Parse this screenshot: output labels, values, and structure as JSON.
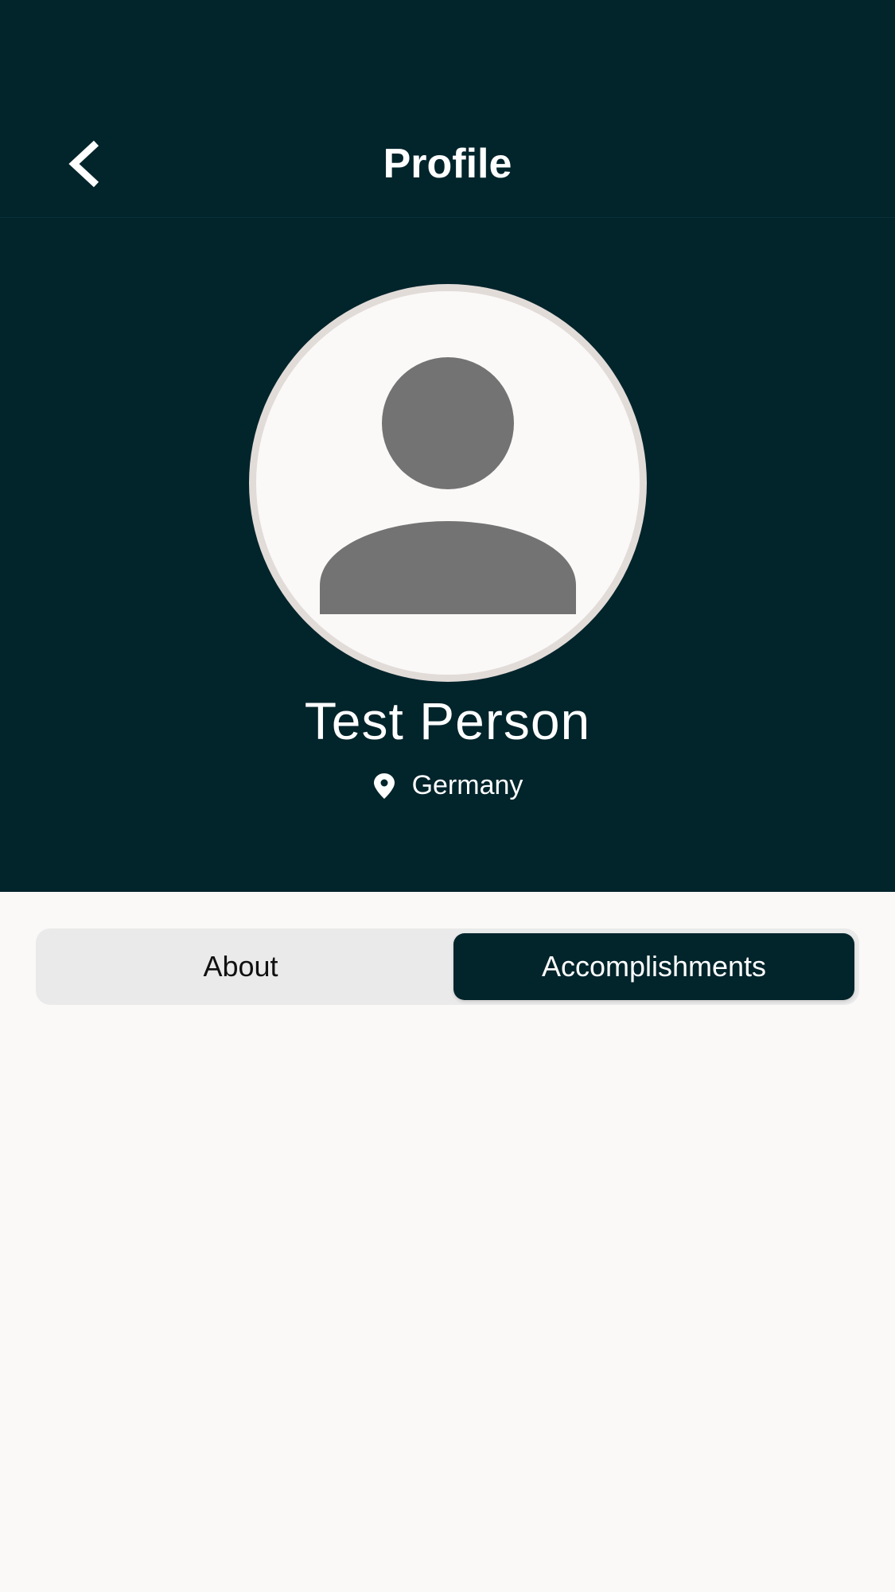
{
  "header": {
    "title": "Profile",
    "back_icon": "chevron-left-icon"
  },
  "profile": {
    "avatar_icon": "person-placeholder-icon",
    "name": "Test Person",
    "location": "Germany",
    "location_icon": "map-pin-icon"
  },
  "tabs": [
    {
      "label": "About",
      "selected": false
    },
    {
      "label": "Accomplishments",
      "selected": true
    }
  ],
  "colors": {
    "hero_background": "#02242b",
    "page_background": "#faf9f8",
    "segment_background": "#eaeaea",
    "selected_segment": "#02242b",
    "avatar_ring": "#e2dcd9",
    "avatar_silhouette": "#737373"
  }
}
